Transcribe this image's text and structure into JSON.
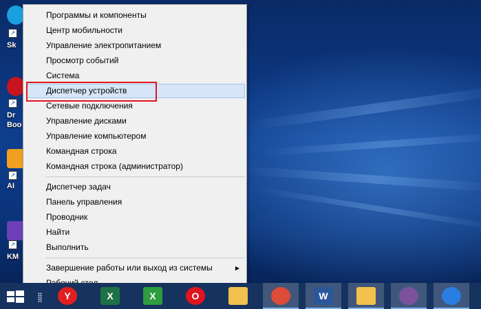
{
  "desktop_icons": [
    {
      "label": "Sk",
      "icon": "skype-shortcut-icon",
      "color": "#1aa0e0"
    },
    {
      "label": "Dr",
      "label2": "Boo",
      "icon": "driver-booster-shortcut-icon",
      "color": "#c8141e"
    },
    {
      "label": "AI",
      "icon": "aimp-shortcut-icon",
      "color": "#f0a020"
    },
    {
      "label": "KM",
      "icon": "kmplayer-shortcut-icon",
      "color": "#6a3fb8"
    }
  ],
  "context_menu": {
    "groups": [
      [
        {
          "label": "Программы и компоненты",
          "key": "п"
        },
        {
          "label": "Центр мобильности"
        },
        {
          "label": "Управление электропитанием"
        },
        {
          "label": "Просмотр событий"
        },
        {
          "label": "Система"
        },
        {
          "label": "Диспетчер устройств",
          "highlighted": true
        },
        {
          "label": "Сетевые подключения"
        },
        {
          "label": "Управление дисками"
        },
        {
          "label": "Управление компьютером"
        },
        {
          "label": "Командная строка"
        },
        {
          "label": "Командная строка (администратор)"
        }
      ],
      [
        {
          "label": "Диспетчер задач"
        },
        {
          "label": "Панель управления"
        },
        {
          "label": "Проводник"
        },
        {
          "label": "Найти"
        },
        {
          "label": "Выполнить"
        }
      ],
      [
        {
          "label": "Завершение работы или выход из системы",
          "submenu": true
        },
        {
          "label": "Рабочий стол"
        }
      ]
    ],
    "submenu_glyph": "▶"
  },
  "taskbar": {
    "items": [
      {
        "name": "yandex-browser-icon",
        "glyph": "Y",
        "color": "#e02020"
      },
      {
        "name": "excel-icon",
        "glyph": "X",
        "color": "#1e7145"
      },
      {
        "name": "excel-green-icon",
        "glyph": "X",
        "color": "#2e9c40"
      },
      {
        "name": "opera-icon",
        "glyph": "O",
        "color": "#e0141e"
      },
      {
        "name": "file-explorer-icon",
        "glyph": "",
        "color": "#f2c14e"
      },
      {
        "name": "chrome-icon",
        "glyph": "",
        "color": "#dd4b39",
        "active": true
      },
      {
        "name": "word-icon",
        "glyph": "W",
        "color": "#2b579a",
        "active": true
      },
      {
        "name": "file-explorer-icon-2",
        "glyph": "",
        "color": "#f2c14e",
        "active": true
      },
      {
        "name": "viber-icon",
        "glyph": "",
        "color": "#7b519d",
        "active": true
      },
      {
        "name": "arrow-app-icon",
        "glyph": "",
        "color": "#2a7de1",
        "active": true
      }
    ]
  },
  "colors": {
    "highlight_box": "#e0141e",
    "menu_bg": "#f0f0f0",
    "taskbar": "#16325e"
  }
}
